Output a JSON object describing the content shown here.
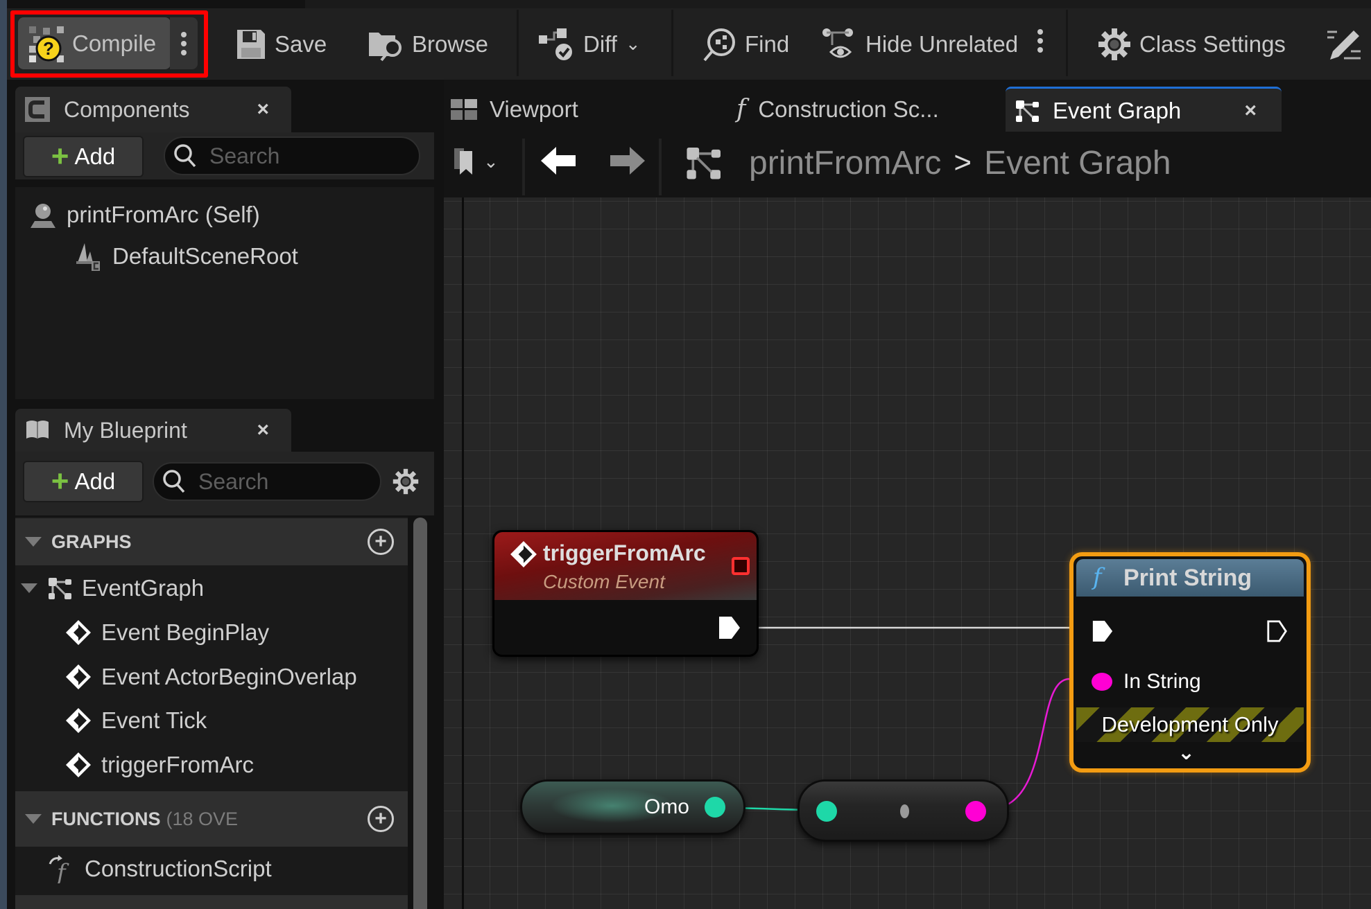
{
  "toolbar": {
    "compile_label": "Compile",
    "compile_status_icon": "question-warning-icon",
    "save_label": "Save",
    "browse_label": "Browse",
    "diff_label": "Diff",
    "find_label": "Find",
    "hide_unrelated_label": "Hide Unrelated",
    "class_settings_label": "Class Settings",
    "highlight_color": "#ff0000"
  },
  "components_panel": {
    "tab_label": "Components",
    "add_label": "Add",
    "search_placeholder": "Search",
    "items": [
      {
        "label": "printFromArc (Self)",
        "icon": "actor-icon"
      },
      {
        "label": "DefaultSceneRoot",
        "icon": "scene-component-icon"
      }
    ]
  },
  "my_blueprint_panel": {
    "tab_label": "My Blueprint",
    "add_label": "Add",
    "search_placeholder": "Search",
    "graphs_header": "GRAPHS",
    "event_graph_label": "EventGraph",
    "events": [
      "Event BeginPlay",
      "Event ActorBeginOverlap",
      "Event Tick",
      "triggerFromArc"
    ],
    "functions_header": "FUNCTIONS",
    "functions_count": "(18 OVE",
    "functions": [
      "ConstructionScript"
    ]
  },
  "editor_tabs": [
    {
      "label": "Viewport",
      "icon": "viewport-icon",
      "active": false
    },
    {
      "label": "Construction Sc...",
      "icon": "function-icon",
      "active": false
    },
    {
      "label": "Event Graph",
      "icon": "event-graph-icon",
      "active": true
    }
  ],
  "breadcrumb": {
    "blueprint": "printFromArc",
    "separator": ">",
    "graph": "Event Graph"
  },
  "nodes": {
    "custom_event": {
      "title": "triggerFromArc",
      "subtitle": "Custom Event",
      "header_color": "#8a1414"
    },
    "print_string": {
      "title": "Print String",
      "input_label": "In String",
      "banner": "Development Only",
      "header_color": "#3f5f78",
      "selection_color": "#f39c12"
    },
    "variable_get": {
      "label": "Omo",
      "pin_color": "#1ed8a8"
    },
    "conversion": {
      "input_pin_color": "#1ed8a8",
      "output_pin_color": "#ff00d4"
    }
  }
}
